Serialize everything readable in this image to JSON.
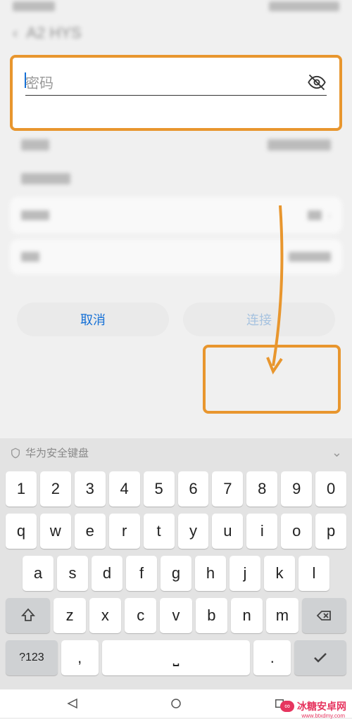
{
  "header": {
    "title": "A2 HYS"
  },
  "password": {
    "placeholder": "密码"
  },
  "buttons": {
    "cancel": "取消",
    "connect": "连接"
  },
  "keyboard": {
    "header_label": "华为安全键盘",
    "row1": [
      "1",
      "2",
      "3",
      "4",
      "5",
      "6",
      "7",
      "8",
      "9",
      "0"
    ],
    "row2": [
      "q",
      "w",
      "e",
      "r",
      "t",
      "y",
      "u",
      "i",
      "o",
      "p"
    ],
    "row3": [
      "a",
      "s",
      "d",
      "f",
      "g",
      "h",
      "j",
      "k",
      "l"
    ],
    "row4": [
      "z",
      "x",
      "c",
      "v",
      "b",
      "n",
      "m"
    ],
    "bottom": {
      "symbols": "?123",
      "comma": ",",
      "period": "."
    }
  },
  "watermark": {
    "brand": "冰糖安卓网",
    "url": "www.btxdmy.com"
  }
}
